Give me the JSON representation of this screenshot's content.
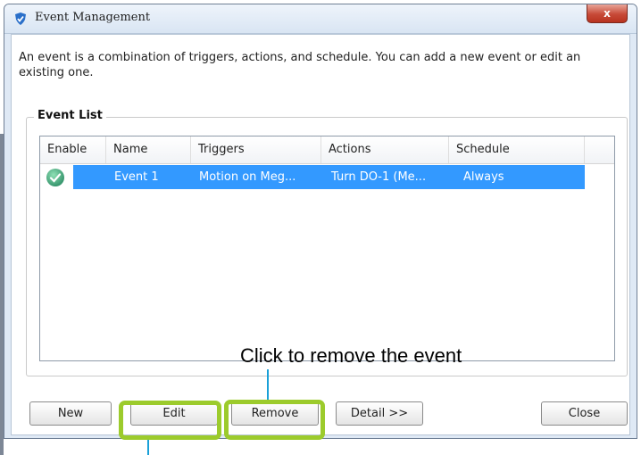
{
  "window": {
    "title": "Event Management",
    "close_label": "x"
  },
  "description": "An event is a combination of triggers, actions, and schedule. You can add a new event or edit an existing one.",
  "event_list": {
    "label": "Event List",
    "columns": [
      "Enable",
      "Name",
      "Triggers",
      "Actions",
      "Schedule"
    ],
    "rows": [
      {
        "enabled": true,
        "name": "Event 1",
        "triggers": "Motion on Meg...",
        "actions": "Turn DO-1 (Me...",
        "schedule": "Always"
      }
    ]
  },
  "buttons": {
    "new": "New",
    "edit": "Edit",
    "remove": "Remove",
    "detail": "Detail >>",
    "close": "Close"
  },
  "annotation": {
    "remove_text": "Click to remove the event"
  },
  "colors": {
    "selection": "#3399ff",
    "highlight": "#9ccb2c",
    "leader": "#1aa0d8",
    "enabled_icon": "#4caf8a"
  },
  "icons": {
    "app": "shield-check-icon",
    "enabled": "check-circle-icon"
  }
}
